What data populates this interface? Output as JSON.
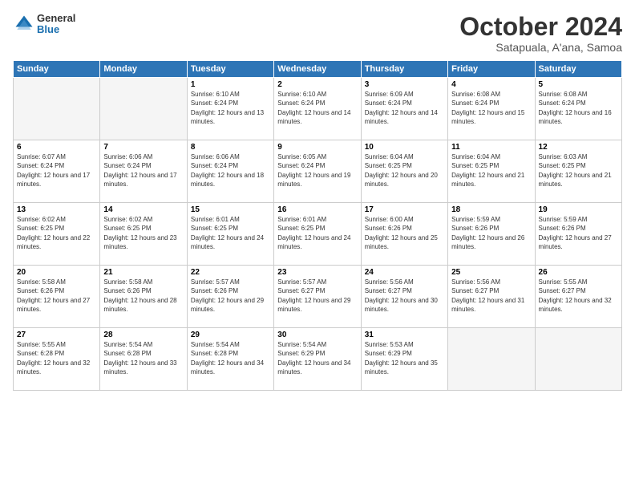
{
  "header": {
    "logo": {
      "general": "General",
      "blue": "Blue"
    },
    "title": "October 2024",
    "location": "Satapuala, A'ana, Samoa"
  },
  "weekdays": [
    "Sunday",
    "Monday",
    "Tuesday",
    "Wednesday",
    "Thursday",
    "Friday",
    "Saturday"
  ],
  "weeks": [
    [
      {
        "day": "",
        "empty": true
      },
      {
        "day": "",
        "empty": true
      },
      {
        "day": "1",
        "sunrise": "6:10 AM",
        "sunset": "6:24 PM",
        "daylight": "12 hours and 13 minutes."
      },
      {
        "day": "2",
        "sunrise": "6:10 AM",
        "sunset": "6:24 PM",
        "daylight": "12 hours and 14 minutes."
      },
      {
        "day": "3",
        "sunrise": "6:09 AM",
        "sunset": "6:24 PM",
        "daylight": "12 hours and 14 minutes."
      },
      {
        "day": "4",
        "sunrise": "6:08 AM",
        "sunset": "6:24 PM",
        "daylight": "12 hours and 15 minutes."
      },
      {
        "day": "5",
        "sunrise": "6:08 AM",
        "sunset": "6:24 PM",
        "daylight": "12 hours and 16 minutes."
      }
    ],
    [
      {
        "day": "6",
        "sunrise": "6:07 AM",
        "sunset": "6:24 PM",
        "daylight": "12 hours and 17 minutes."
      },
      {
        "day": "7",
        "sunrise": "6:06 AM",
        "sunset": "6:24 PM",
        "daylight": "12 hours and 17 minutes."
      },
      {
        "day": "8",
        "sunrise": "6:06 AM",
        "sunset": "6:24 PM",
        "daylight": "12 hours and 18 minutes."
      },
      {
        "day": "9",
        "sunrise": "6:05 AM",
        "sunset": "6:24 PM",
        "daylight": "12 hours and 19 minutes."
      },
      {
        "day": "10",
        "sunrise": "6:04 AM",
        "sunset": "6:25 PM",
        "daylight": "12 hours and 20 minutes."
      },
      {
        "day": "11",
        "sunrise": "6:04 AM",
        "sunset": "6:25 PM",
        "daylight": "12 hours and 21 minutes."
      },
      {
        "day": "12",
        "sunrise": "6:03 AM",
        "sunset": "6:25 PM",
        "daylight": "12 hours and 21 minutes."
      }
    ],
    [
      {
        "day": "13",
        "sunrise": "6:02 AM",
        "sunset": "6:25 PM",
        "daylight": "12 hours and 22 minutes."
      },
      {
        "day": "14",
        "sunrise": "6:02 AM",
        "sunset": "6:25 PM",
        "daylight": "12 hours and 23 minutes."
      },
      {
        "day": "15",
        "sunrise": "6:01 AM",
        "sunset": "6:25 PM",
        "daylight": "12 hours and 24 minutes."
      },
      {
        "day": "16",
        "sunrise": "6:01 AM",
        "sunset": "6:25 PM",
        "daylight": "12 hours and 24 minutes."
      },
      {
        "day": "17",
        "sunrise": "6:00 AM",
        "sunset": "6:26 PM",
        "daylight": "12 hours and 25 minutes."
      },
      {
        "day": "18",
        "sunrise": "5:59 AM",
        "sunset": "6:26 PM",
        "daylight": "12 hours and 26 minutes."
      },
      {
        "day": "19",
        "sunrise": "5:59 AM",
        "sunset": "6:26 PM",
        "daylight": "12 hours and 27 minutes."
      }
    ],
    [
      {
        "day": "20",
        "sunrise": "5:58 AM",
        "sunset": "6:26 PM",
        "daylight": "12 hours and 27 minutes."
      },
      {
        "day": "21",
        "sunrise": "5:58 AM",
        "sunset": "6:26 PM",
        "daylight": "12 hours and 28 minutes."
      },
      {
        "day": "22",
        "sunrise": "5:57 AM",
        "sunset": "6:26 PM",
        "daylight": "12 hours and 29 minutes."
      },
      {
        "day": "23",
        "sunrise": "5:57 AM",
        "sunset": "6:27 PM",
        "daylight": "12 hours and 29 minutes."
      },
      {
        "day": "24",
        "sunrise": "5:56 AM",
        "sunset": "6:27 PM",
        "daylight": "12 hours and 30 minutes."
      },
      {
        "day": "25",
        "sunrise": "5:56 AM",
        "sunset": "6:27 PM",
        "daylight": "12 hours and 31 minutes."
      },
      {
        "day": "26",
        "sunrise": "5:55 AM",
        "sunset": "6:27 PM",
        "daylight": "12 hours and 32 minutes."
      }
    ],
    [
      {
        "day": "27",
        "sunrise": "5:55 AM",
        "sunset": "6:28 PM",
        "daylight": "12 hours and 32 minutes."
      },
      {
        "day": "28",
        "sunrise": "5:54 AM",
        "sunset": "6:28 PM",
        "daylight": "12 hours and 33 minutes."
      },
      {
        "day": "29",
        "sunrise": "5:54 AM",
        "sunset": "6:28 PM",
        "daylight": "12 hours and 34 minutes."
      },
      {
        "day": "30",
        "sunrise": "5:54 AM",
        "sunset": "6:29 PM",
        "daylight": "12 hours and 34 minutes."
      },
      {
        "day": "31",
        "sunrise": "5:53 AM",
        "sunset": "6:29 PM",
        "daylight": "12 hours and 35 minutes."
      },
      {
        "day": "",
        "empty": true
      },
      {
        "day": "",
        "empty": true
      }
    ]
  ]
}
